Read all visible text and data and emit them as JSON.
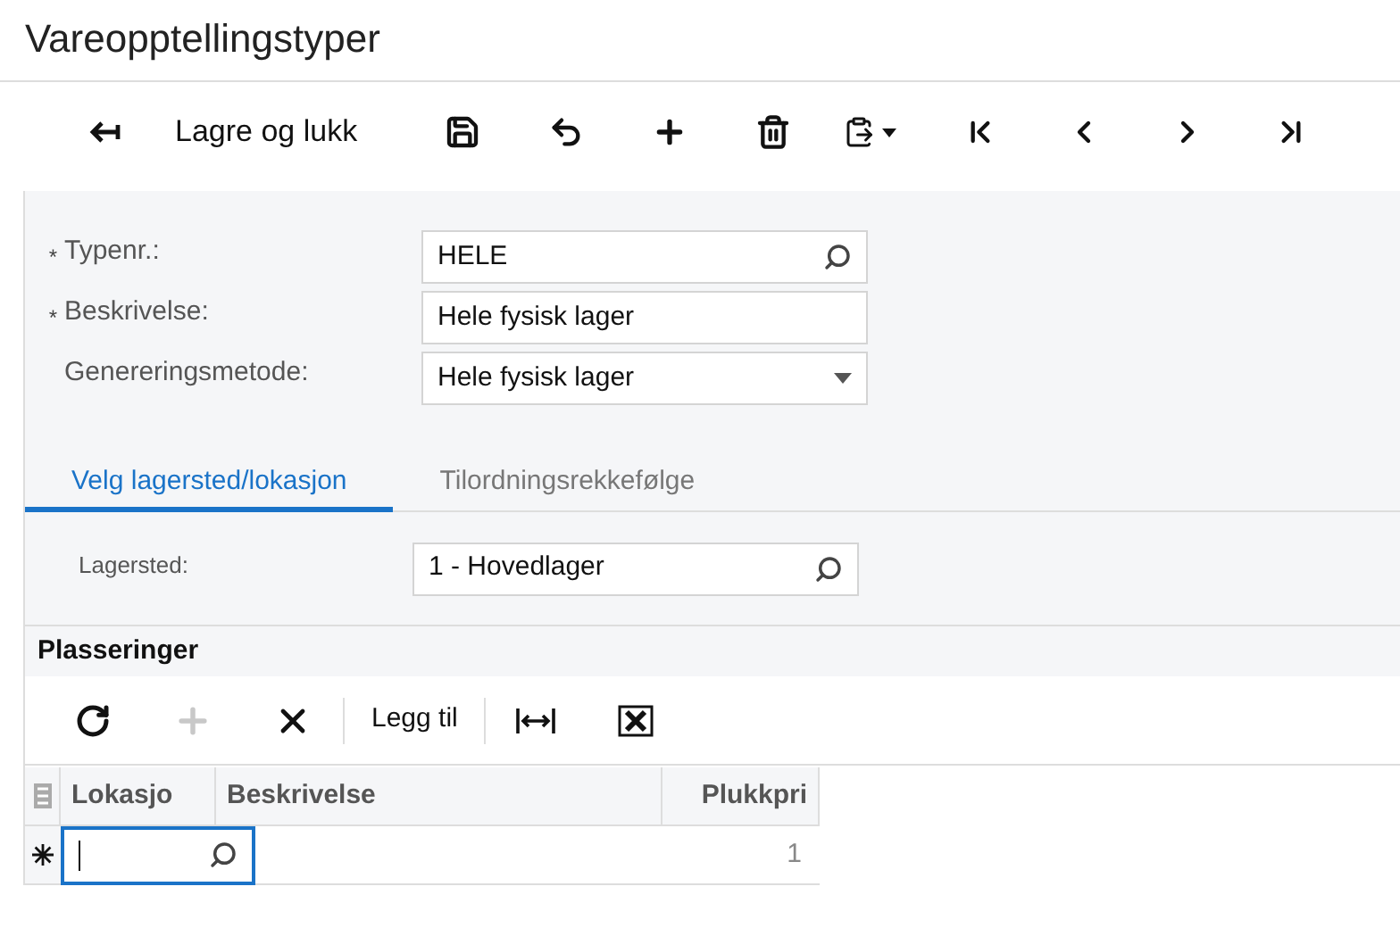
{
  "window": {
    "title": "Vareopptellingstyper"
  },
  "toolbar": [
    {
      "kind": "back"
    },
    {
      "kind": "text",
      "label": "Lagre og lukk"
    },
    {
      "kind": "save"
    },
    {
      "kind": "undo"
    },
    {
      "kind": "add"
    },
    {
      "kind": "delete"
    },
    {
      "kind": "paste"
    },
    {
      "kind": "first"
    },
    {
      "kind": "prev"
    },
    {
      "kind": "next"
    },
    {
      "kind": "last"
    }
  ],
  "form": {
    "fields": [
      {
        "label": "Typenr.:",
        "required": true,
        "value": "HELE",
        "kind": "lookup"
      },
      {
        "label": "Beskrivelse:",
        "required": true,
        "value": "Hele fysisk lager",
        "kind": "text"
      },
      {
        "label": "Genereringsmetode:",
        "required": false,
        "value": "Hele fysisk lager",
        "kind": "select"
      }
    ],
    "required_mark": "*"
  },
  "tabs": [
    {
      "label": "Velg lagersted/lokasjon",
      "selected": true
    },
    {
      "label": "Tilordningsrekkefølge",
      "selected": false
    }
  ],
  "warehouse": {
    "label": "Lagersted:",
    "value": "1 - Hovedlager"
  },
  "grid": {
    "title": "Plasseringer",
    "toolbar": [
      {
        "kind": "refresh",
        "disabled": false
      },
      {
        "kind": "add",
        "disabled": true
      },
      {
        "kind": "remove",
        "disabled": false
      },
      {
        "kind": "text",
        "label": "Legg til",
        "disabled": false
      },
      {
        "kind": "fit",
        "disabled": false
      },
      {
        "kind": "excel",
        "disabled": false
      }
    ],
    "columns": [
      "Lokasjo",
      "Beskrivelse",
      "Plukkpri"
    ],
    "rows": [
      {
        "new": true,
        "priority": "1",
        "editing": true
      }
    ]
  }
}
